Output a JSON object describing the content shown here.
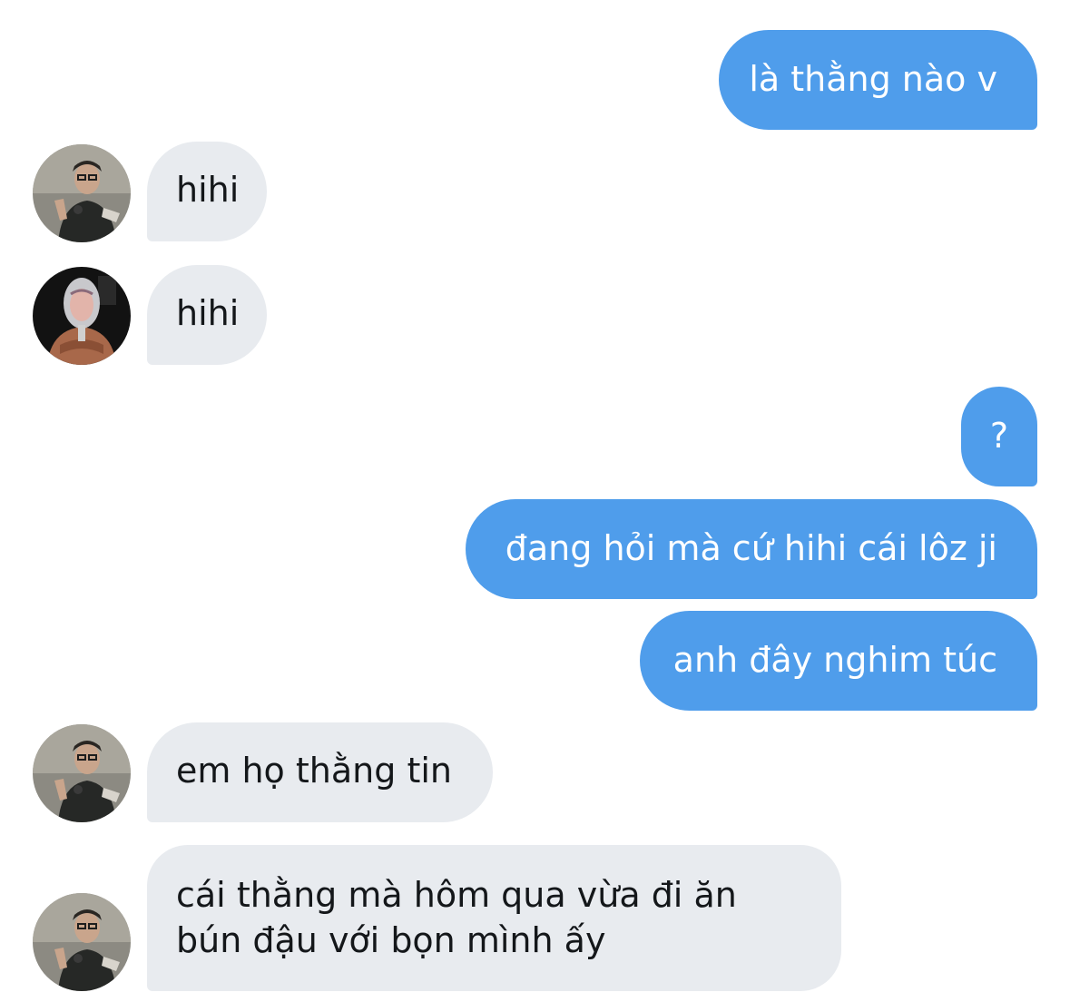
{
  "messages": [
    {
      "sender": "me",
      "text": "là thằng nào v"
    },
    {
      "sender": "contact-a",
      "text": "hihi"
    },
    {
      "sender": "contact-b",
      "text": "hihi"
    },
    {
      "sender": "me",
      "text": "?"
    },
    {
      "sender": "me",
      "text": "đang hỏi mà cứ hihi cái lôz ji"
    },
    {
      "sender": "me",
      "text": "anh đây nghim túc"
    },
    {
      "sender": "contact-a",
      "text": "em họ thằng tin"
    },
    {
      "sender": "contact-a",
      "lines": [
        "cái thằng mà hôm qua vừa đi ăn",
        "bún đậu với bọn mình ấy"
      ]
    }
  ],
  "colors": {
    "outgoing_bubble": "#4f9deb",
    "incoming_bubble": "#e8ebef",
    "outgoing_text": "#ffffff",
    "incoming_text": "#14171a"
  },
  "icons": {
    "contact_a_avatar": "person-photo-avatar",
    "contact_b_avatar": "hooded-person-photo-avatar"
  }
}
